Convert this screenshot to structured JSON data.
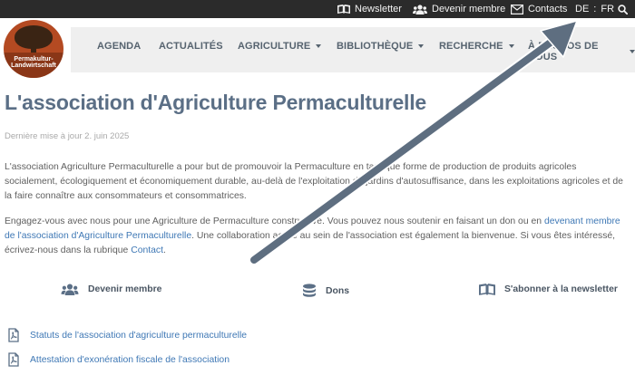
{
  "topbar": {
    "newsletter": "Newsletter",
    "member": "Devenir membre",
    "contacts": "Contacts",
    "lang_de": "DE",
    "lang_sep": ":",
    "lang_fr": "FR"
  },
  "logo": {
    "line1": "Permakultur-",
    "line2": "Landwirtschaft"
  },
  "nav": {
    "agenda": "AGENDA",
    "actualites": "ACTUALITÉS",
    "agriculture": "AGRICULTURE",
    "bibliotheque": "BIBLIOTHÈQUE",
    "recherche": "RECHERCHE",
    "apropos": "À PROPOS DE NOUS"
  },
  "page": {
    "title": "L'association d'Agriculture Permaculturelle",
    "updated": "Dernière mise à jour 2. juin 2025",
    "para1": "L'association Agriculture Permaculturelle a pour but de promouvoir la Permaculture en tant que forme de production de produits agricoles socialement, écologiquement et économiquement durable, au-delà de l'exploitation de jardins d'autosuffisance, dans les exploitations agricoles et de la faire connaître aux consommateurs et consommatrices.",
    "para2_a": "Engagez-vous avec nous pour une Agriculture de Permaculture constructive. Vous pouvez nous soutenir en faisant un don ou en ",
    "para2_link1": "devenant membre de l'association d'Agriculture Permaculturelle",
    "para2_b": ". Une collaboration active au sein de l'association est également la bienvenue. Si vous êtes intéressé, écrivez-nous dans la rubrique ",
    "para2_link2": "Contact",
    "para2_c": "."
  },
  "cta": {
    "member": "Devenir membre",
    "dons": "Dons",
    "newsletter": "S'abonner à la newsletter"
  },
  "documents": [
    "Statuts de l'association d'agriculture permaculturelle",
    "Attestation d'exonération fiscale de l'association"
  ],
  "colors": {
    "topbar_bg": "#2b2b2b",
    "title": "#5b6f86",
    "link": "#3f78b5",
    "arrow": "#5e6e80"
  },
  "icons": {
    "newsletter": "book-open-icon",
    "member": "users-icon",
    "contacts": "envelope-icon",
    "search": "search-icon",
    "dons": "coins-stack-icon",
    "document": "pdf-file-icon"
  }
}
